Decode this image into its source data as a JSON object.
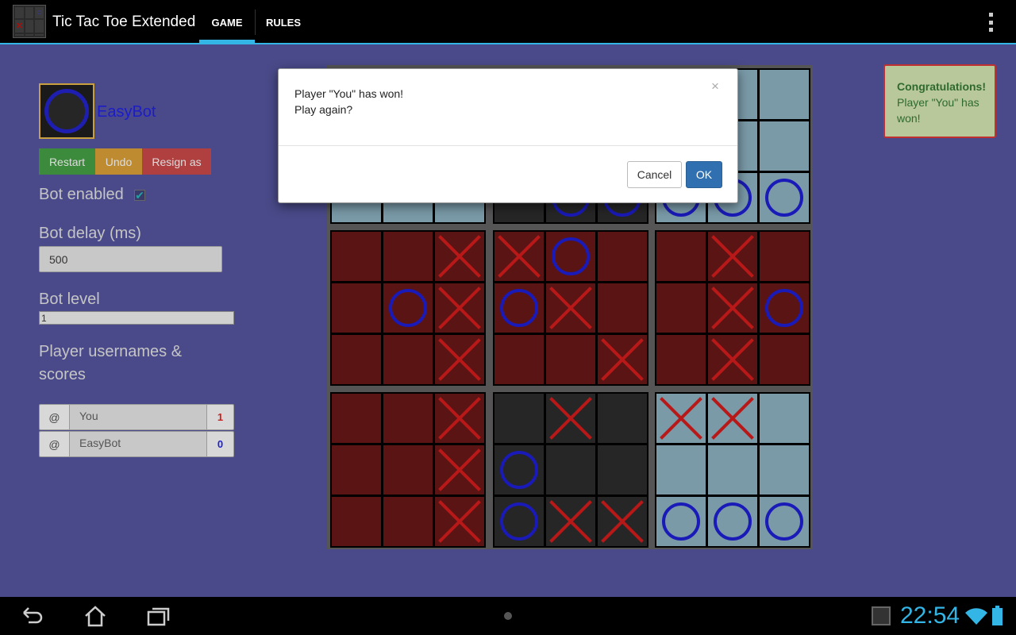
{
  "app": {
    "title": "Tic Tac Toe Extended",
    "tabs": [
      {
        "label": "GAME",
        "selected": true
      },
      {
        "label": "RULES",
        "selected": false
      }
    ],
    "accent_color": "#33b5e5"
  },
  "sidebar": {
    "current_player": "EasyBot",
    "buttons": {
      "restart": "Restart",
      "undo": "Undo",
      "resign": "Resign as"
    },
    "bot_enabled_label": "Bot enabled",
    "bot_enabled_checked": true,
    "bot_delay_label": "Bot delay (ms)",
    "bot_delay_value": "500",
    "bot_level_label": "Bot level",
    "bot_level_value": "1",
    "players_label": "Player usernames & scores",
    "players": [
      {
        "prefix": "@",
        "placeholder": "You",
        "score": "1",
        "color": "#cc2020"
      },
      {
        "prefix": "@",
        "placeholder": "EasyBot",
        "score": "0",
        "color": "#2020cc"
      }
    ]
  },
  "board": {
    "colors": {
      "red": "#5a1414",
      "blue": "#7a9aa8",
      "dark": "#262626",
      "x": "#b81818",
      "o": "#1a1ab8"
    },
    "minis": [
      {
        "style": "blue",
        "cells": [
          "",
          "",
          "",
          "",
          "",
          "",
          "",
          "",
          ""
        ]
      },
      {
        "style": "dark",
        "cells": [
          "",
          "",
          "",
          "",
          "",
          "",
          "",
          "O",
          "O"
        ]
      },
      {
        "style": "blue",
        "cells": [
          "",
          "",
          "",
          "",
          "",
          "",
          "O",
          "O",
          "O"
        ]
      },
      {
        "style": "red",
        "cells": [
          "",
          "",
          "X",
          "",
          "O",
          "X",
          "",
          "",
          "X"
        ]
      },
      {
        "style": "red",
        "cells": [
          "X",
          "O",
          "",
          "O",
          "X",
          "",
          "",
          "",
          "X"
        ]
      },
      {
        "style": "red",
        "cells": [
          "",
          "X",
          "",
          "",
          "X",
          "O",
          "",
          "X",
          ""
        ]
      },
      {
        "style": "red",
        "cells": [
          "",
          "",
          "X",
          "",
          "",
          "X",
          "",
          "",
          "X"
        ]
      },
      {
        "style": "dark",
        "cells": [
          "",
          "X",
          "",
          "O",
          "",
          "",
          "O",
          "X",
          "X"
        ]
      },
      {
        "style": "blue",
        "cells": [
          "X",
          "X",
          "",
          "",
          "",
          "",
          "O",
          "O",
          "O"
        ]
      }
    ]
  },
  "alert": {
    "heading": "Congratulations!",
    "body": "Player \"You\" has won!"
  },
  "dialog": {
    "line1": "Player \"You\" has won!",
    "line2": "Play again?",
    "close": "×",
    "cancel": "Cancel",
    "ok": "OK"
  },
  "statusbar": {
    "time": "22:54"
  }
}
